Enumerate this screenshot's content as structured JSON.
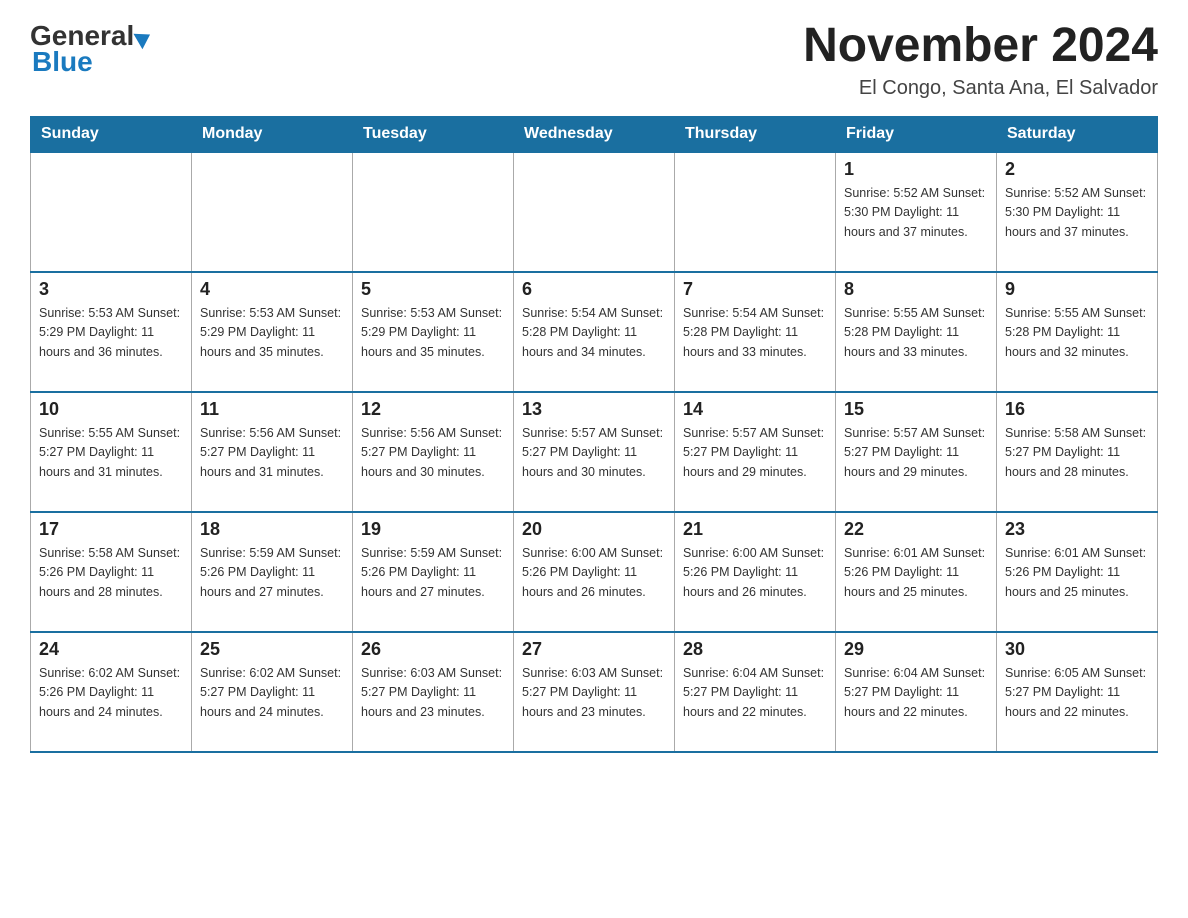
{
  "header": {
    "logo_line1": "General",
    "logo_line2": "Blue",
    "title": "November 2024",
    "subtitle": "El Congo, Santa Ana, El Salvador"
  },
  "calendar": {
    "days_of_week": [
      "Sunday",
      "Monday",
      "Tuesday",
      "Wednesday",
      "Thursday",
      "Friday",
      "Saturday"
    ],
    "weeks": [
      [
        {
          "day": "",
          "info": ""
        },
        {
          "day": "",
          "info": ""
        },
        {
          "day": "",
          "info": ""
        },
        {
          "day": "",
          "info": ""
        },
        {
          "day": "",
          "info": ""
        },
        {
          "day": "1",
          "info": "Sunrise: 5:52 AM\nSunset: 5:30 PM\nDaylight: 11 hours and 37 minutes."
        },
        {
          "day": "2",
          "info": "Sunrise: 5:52 AM\nSunset: 5:30 PM\nDaylight: 11 hours and 37 minutes."
        }
      ],
      [
        {
          "day": "3",
          "info": "Sunrise: 5:53 AM\nSunset: 5:29 PM\nDaylight: 11 hours and 36 minutes."
        },
        {
          "day": "4",
          "info": "Sunrise: 5:53 AM\nSunset: 5:29 PM\nDaylight: 11 hours and 35 minutes."
        },
        {
          "day": "5",
          "info": "Sunrise: 5:53 AM\nSunset: 5:29 PM\nDaylight: 11 hours and 35 minutes."
        },
        {
          "day": "6",
          "info": "Sunrise: 5:54 AM\nSunset: 5:28 PM\nDaylight: 11 hours and 34 minutes."
        },
        {
          "day": "7",
          "info": "Sunrise: 5:54 AM\nSunset: 5:28 PM\nDaylight: 11 hours and 33 minutes."
        },
        {
          "day": "8",
          "info": "Sunrise: 5:55 AM\nSunset: 5:28 PM\nDaylight: 11 hours and 33 minutes."
        },
        {
          "day": "9",
          "info": "Sunrise: 5:55 AM\nSunset: 5:28 PM\nDaylight: 11 hours and 32 minutes."
        }
      ],
      [
        {
          "day": "10",
          "info": "Sunrise: 5:55 AM\nSunset: 5:27 PM\nDaylight: 11 hours and 31 minutes."
        },
        {
          "day": "11",
          "info": "Sunrise: 5:56 AM\nSunset: 5:27 PM\nDaylight: 11 hours and 31 minutes."
        },
        {
          "day": "12",
          "info": "Sunrise: 5:56 AM\nSunset: 5:27 PM\nDaylight: 11 hours and 30 minutes."
        },
        {
          "day": "13",
          "info": "Sunrise: 5:57 AM\nSunset: 5:27 PM\nDaylight: 11 hours and 30 minutes."
        },
        {
          "day": "14",
          "info": "Sunrise: 5:57 AM\nSunset: 5:27 PM\nDaylight: 11 hours and 29 minutes."
        },
        {
          "day": "15",
          "info": "Sunrise: 5:57 AM\nSunset: 5:27 PM\nDaylight: 11 hours and 29 minutes."
        },
        {
          "day": "16",
          "info": "Sunrise: 5:58 AM\nSunset: 5:27 PM\nDaylight: 11 hours and 28 minutes."
        }
      ],
      [
        {
          "day": "17",
          "info": "Sunrise: 5:58 AM\nSunset: 5:26 PM\nDaylight: 11 hours and 28 minutes."
        },
        {
          "day": "18",
          "info": "Sunrise: 5:59 AM\nSunset: 5:26 PM\nDaylight: 11 hours and 27 minutes."
        },
        {
          "day": "19",
          "info": "Sunrise: 5:59 AM\nSunset: 5:26 PM\nDaylight: 11 hours and 27 minutes."
        },
        {
          "day": "20",
          "info": "Sunrise: 6:00 AM\nSunset: 5:26 PM\nDaylight: 11 hours and 26 minutes."
        },
        {
          "day": "21",
          "info": "Sunrise: 6:00 AM\nSunset: 5:26 PM\nDaylight: 11 hours and 26 minutes."
        },
        {
          "day": "22",
          "info": "Sunrise: 6:01 AM\nSunset: 5:26 PM\nDaylight: 11 hours and 25 minutes."
        },
        {
          "day": "23",
          "info": "Sunrise: 6:01 AM\nSunset: 5:26 PM\nDaylight: 11 hours and 25 minutes."
        }
      ],
      [
        {
          "day": "24",
          "info": "Sunrise: 6:02 AM\nSunset: 5:26 PM\nDaylight: 11 hours and 24 minutes."
        },
        {
          "day": "25",
          "info": "Sunrise: 6:02 AM\nSunset: 5:27 PM\nDaylight: 11 hours and 24 minutes."
        },
        {
          "day": "26",
          "info": "Sunrise: 6:03 AM\nSunset: 5:27 PM\nDaylight: 11 hours and 23 minutes."
        },
        {
          "day": "27",
          "info": "Sunrise: 6:03 AM\nSunset: 5:27 PM\nDaylight: 11 hours and 23 minutes."
        },
        {
          "day": "28",
          "info": "Sunrise: 6:04 AM\nSunset: 5:27 PM\nDaylight: 11 hours and 22 minutes."
        },
        {
          "day": "29",
          "info": "Sunrise: 6:04 AM\nSunset: 5:27 PM\nDaylight: 11 hours and 22 minutes."
        },
        {
          "day": "30",
          "info": "Sunrise: 6:05 AM\nSunset: 5:27 PM\nDaylight: 11 hours and 22 minutes."
        }
      ]
    ]
  }
}
